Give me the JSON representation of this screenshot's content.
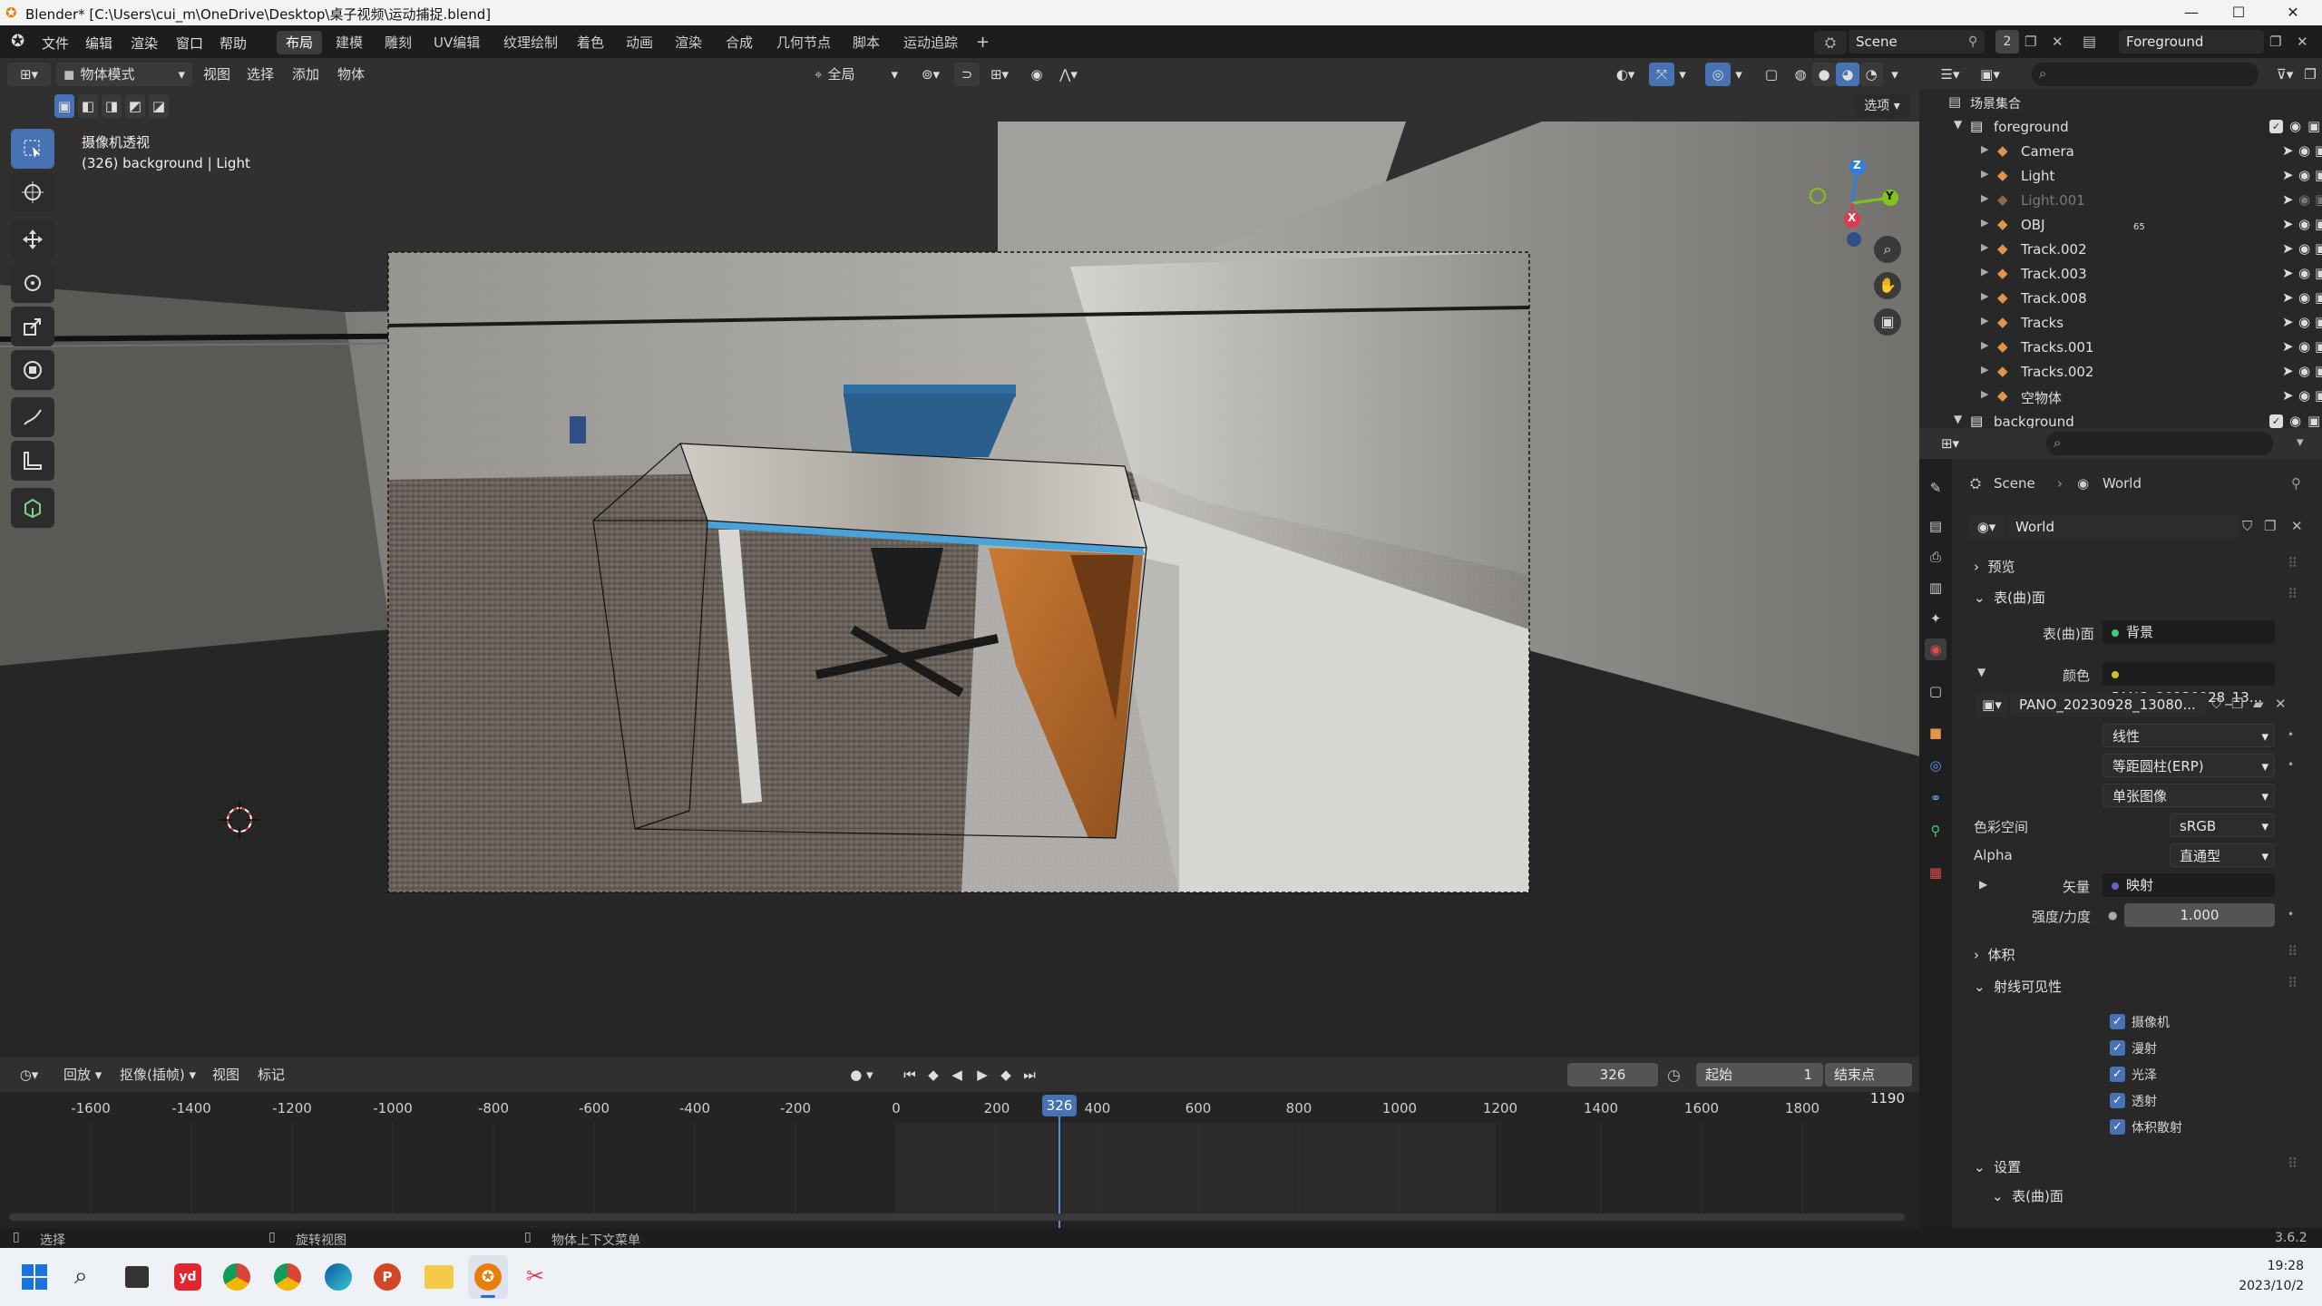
{
  "window": {
    "title": "Blender* [C:\\Users\\cui_m\\OneDrive\\Desktop\\桌子视频\\运动捕捉.blend]",
    "controls": {
      "minimize": "—",
      "maximize": "☐",
      "close": "✕"
    }
  },
  "menubar": {
    "items": [
      "文件",
      "编辑",
      "渲染",
      "窗口",
      "帮助"
    ],
    "workspaces": [
      "布局",
      "建模",
      "雕刻",
      "UV编辑",
      "纹理绘制",
      "着色",
      "动画",
      "渲染",
      "合成",
      "几何节点",
      "脚本",
      "运动追踪"
    ],
    "active_workspace": "布局",
    "add_tab": "+",
    "scene": "Scene",
    "scene_users": "2",
    "view_layer": "Foreground"
  },
  "viewport_header": {
    "mode": "物体模式",
    "menus": [
      "视图",
      "选择",
      "添加",
      "物体"
    ],
    "transform_orientation": "全局",
    "options": "选项"
  },
  "viewport": {
    "camera_label": "摄像机透视",
    "info": "(326) background | Light",
    "gizmo": {
      "z": "Z",
      "y": "Y",
      "x": "X"
    }
  },
  "timeline": {
    "menus": [
      "回放",
      "抠像(插帧)",
      "视图",
      "标记"
    ],
    "current_frame": "326",
    "start_label": "起始",
    "start": "1",
    "end_label": "结束点",
    "end": "1190",
    "ruler": [
      "-1600",
      "-1400",
      "-1200",
      "-1000",
      "-800",
      "-600",
      "-400",
      "-200",
      "0",
      "200",
      "400",
      "600",
      "800",
      "1000",
      "1200",
      "1400",
      "1600",
      "1800"
    ],
    "playhead_label": "326"
  },
  "statusbar": {
    "left": "选择",
    "middle": "旋转视图",
    "right": "物体上下文菜单",
    "version": "3.6.2"
  },
  "outliner": {
    "root": "场景集合",
    "collection_foreground": "foreground",
    "items": [
      {
        "name": "Camera",
        "color": "#e2954a",
        "dim": false
      },
      {
        "name": "Light",
        "color": "#e2954a",
        "dim": false
      },
      {
        "name": "Light.001",
        "color": "#8a6a4a",
        "dim": true
      },
      {
        "name": "OBJ",
        "color": "#e2954a",
        "dim": false,
        "badge": "65"
      },
      {
        "name": "Track.002",
        "color": "#e2954a",
        "dim": false
      },
      {
        "name": "Track.003",
        "color": "#e2954a",
        "dim": false
      },
      {
        "name": "Track.008",
        "color": "#e2954a",
        "dim": false
      },
      {
        "name": "Tracks",
        "color": "#e2954a",
        "dim": false
      },
      {
        "name": "Tracks.001",
        "color": "#e2954a",
        "dim": false
      },
      {
        "name": "Tracks.002",
        "color": "#e2954a",
        "dim": false
      },
      {
        "name": "空物体",
        "color": "#e2954a",
        "dim": false
      }
    ],
    "collection_background": "background"
  },
  "properties": {
    "breadcrumb_scene": "Scene",
    "breadcrumb_world": "World",
    "world_name": "World",
    "section_preview": "预览",
    "section_surface": "表(曲)面",
    "surface_label": "表(曲)面",
    "surface_value": "背景",
    "color_label": "颜色",
    "color_value": "PANO_20230928_13...",
    "image_name": "PANO_20230928_13080...",
    "interpolation": "线性",
    "projection": "等距圆柱(ERP)",
    "source": "单张图像",
    "colorspace_label": "色彩空间",
    "colorspace_value": "sRGB",
    "alpha_label": "Alpha",
    "alpha_value": "直通型",
    "vector_label": "矢量",
    "vector_value": "映射",
    "strength_label": "强度/力度",
    "strength_value": "1.000",
    "section_volume": "体积",
    "section_ray": "射线可见性",
    "ray_items": [
      "摄像机",
      "漫射",
      "光泽",
      "透射",
      "体积散射"
    ],
    "section_settings": "设置",
    "sub_surface": "表(曲)面"
  },
  "taskbar": {
    "time": "19:28",
    "date": "2023/10/2"
  }
}
